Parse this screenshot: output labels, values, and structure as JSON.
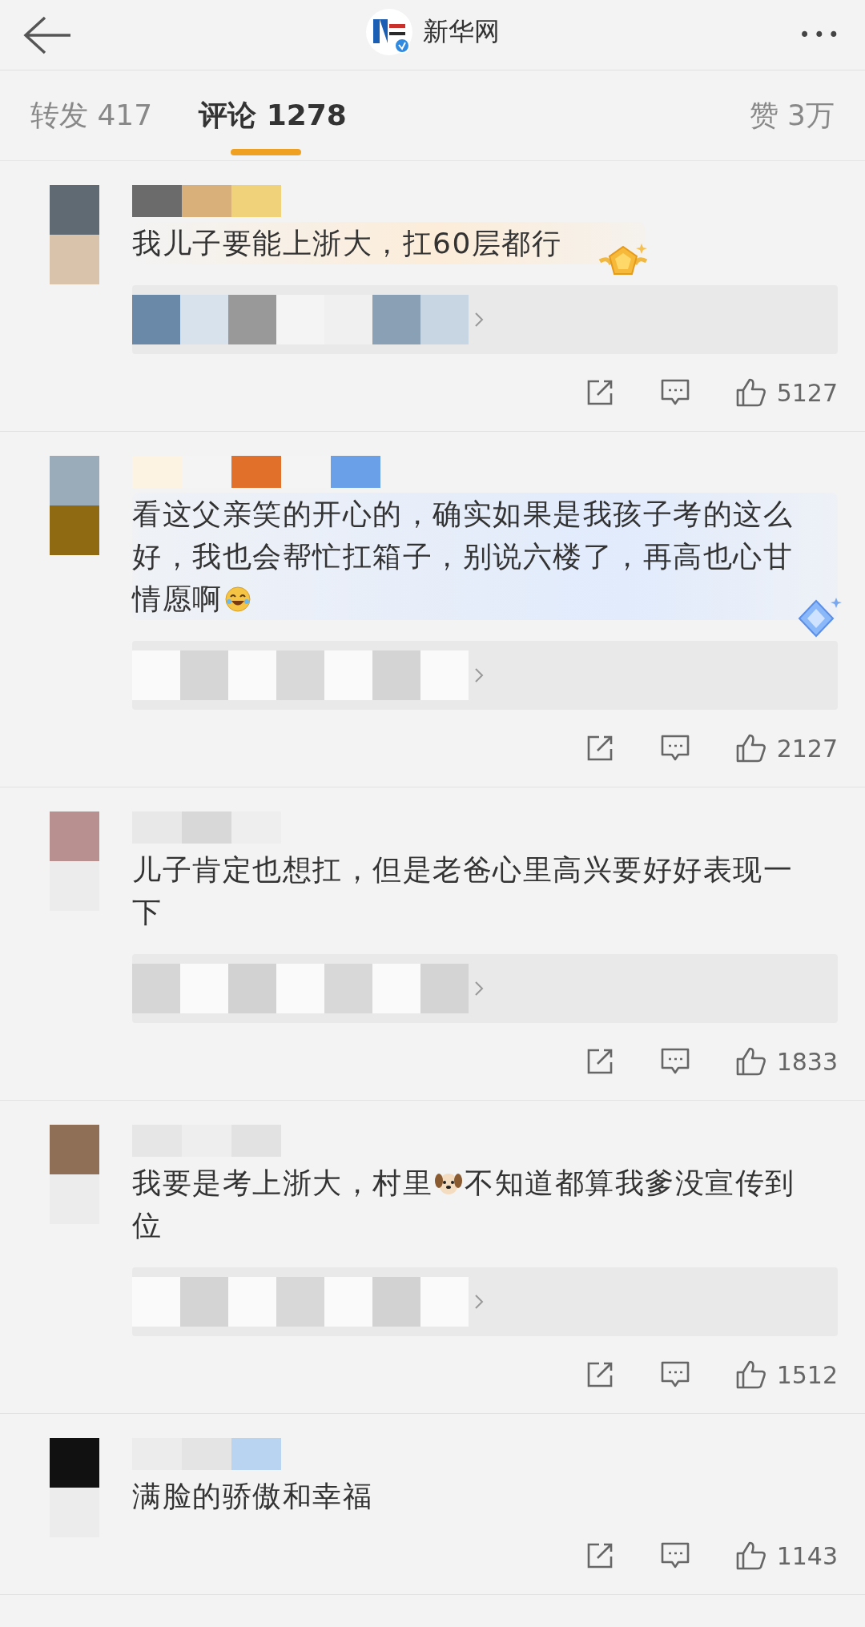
{
  "header": {
    "title": "新华网",
    "more": "•••"
  },
  "tabs": [
    {
      "label": "转发",
      "count": "417",
      "selected": false
    },
    {
      "label": "评论",
      "count": "1278",
      "selected": true
    },
    {
      "label": "赞",
      "count": "3万",
      "selected": false
    }
  ],
  "comments": [
    {
      "parts": [
        {
          "kind": "text",
          "text": "我儿子要能上浙大，扛60层都行"
        }
      ],
      "kind": "gold-badge",
      "replies": true,
      "likes": "5127"
    },
    {
      "parts": [
        {
          "kind": "text",
          "text": "看这父亲笑的开心的，确实如果是我孩子考的这么好，我也会帮忙扛箱子，别说六楼了，再高也心甘情愿啊"
        },
        {
          "kind": "laughing"
        }
      ],
      "kind": "blue-badge",
      "replies": true,
      "likes": "2127"
    },
    {
      "parts": [
        {
          "kind": "text",
          "text": "儿子肯定也想扛，但是老爸心里高兴要好好表现一下"
        }
      ],
      "kind": "plain",
      "replies": true,
      "likes": "1833"
    },
    {
      "parts": [
        {
          "kind": "text",
          "text": "我要是考上浙大，村里"
        },
        {
          "kind": "dog"
        },
        {
          "kind": "text",
          "text": "不知道都算我爹没宣传到位"
        }
      ],
      "kind": "plain",
      "replies": true,
      "likes": "1512"
    },
    {
      "parts": [
        {
          "kind": "text",
          "text": "满脸的骄傲和幸福"
        }
      ],
      "kind": "plain",
      "replies": false,
      "likes": "1143"
    }
  ]
}
